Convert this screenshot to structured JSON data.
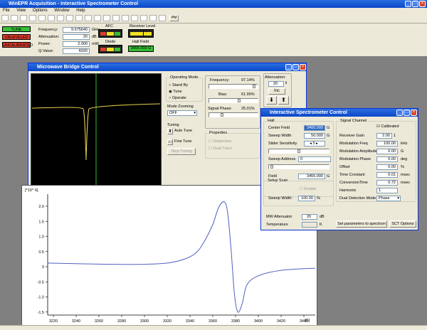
{
  "app": {
    "title": "WinEPR Acquisition - Interactive Spectrometer Control",
    "menu": [
      "File",
      "View",
      "Options",
      "Window",
      "Help"
    ],
    "toolbar_text": "PM"
  },
  "status": {
    "tune": "TUNE",
    "unleveled": "UNLEVELED",
    "uncalibrated": "UNCALIBRATED"
  },
  "top": {
    "frequency_label": "Frequency:",
    "frequency": "9.675640",
    "frequency_unit": "GHz",
    "attenuation_label": "Attenuation:",
    "attenuation": "20",
    "attenuation_unit": "dB",
    "power_label": "Power:",
    "power": "2.000",
    "power_unit": "mW",
    "qvalue_label": "Q-Value:",
    "qvalue": "6020",
    "afc": "AFC",
    "receiver_level": "Receiver Level",
    "diode": "Diode",
    "hall_field": "Hall Field",
    "hall_value": "3455.000 G"
  },
  "mw": {
    "title": "Microwave Bridge Control",
    "operating_mode": "Operating Mode",
    "standby": "Stand By",
    "tune": "Tune",
    "operate": "Operate",
    "mode_zooming": "Mode Zooming",
    "zoom_value": "OFF",
    "tuning": "Tuning",
    "auto_tune": "Auto Tune",
    "fine_tune": "Fine Tune",
    "stop_tuning": "Stop Tuning",
    "frequency_label": "Frequency:",
    "frequency_pct": "97.14%",
    "bias_label": "Bias:",
    "bias_pct": "61.95%",
    "signal_phase_label": "Signal Phase:",
    "signal_phase_pct": "25.01%",
    "attenuation_label": "Attenuation:",
    "attenuation_value": "20",
    "inc": "Inc",
    "properties": "Properties",
    "dispersion": "Dispersion",
    "dual_trace": "Dual Trace"
  },
  "isc": {
    "title": "Interactive Spectrometer Control",
    "hall": "Hall",
    "center_field_label": "Center Field",
    "center_field": "3400.000",
    "unit_g": "G",
    "sweep_width_label": "Sweep Width",
    "sweep_width": "50.000",
    "slider_sens_label": "Slider Sensitivity",
    "slider_sens": "5",
    "sweep_address_label": "Sweep Address",
    "sweep_address": "0",
    "field_label": "Field",
    "field": "3455.000",
    "setup_scan": "Setup Scan",
    "enable": "Enable",
    "setup_sweep_label": "Sweep Width:",
    "setup_sweep": "100.00",
    "pct": "%",
    "mw_att_label": "MW Attenuator",
    "mw_att": "20",
    "mw_att_unit": "dB",
    "temperature_label": "Temperature",
    "temp_unit": "K",
    "signal_channel": "Signal Channel",
    "calibrated": "Calibrated",
    "receiver_gain_label": "Receiver Gain",
    "receiver_gain": "2.00",
    "gain_exp": "1",
    "mod_freq_label": "Modulation Freq",
    "mod_freq": "100.00",
    "khz": "kHz",
    "mod_amp_label": "Modulation Amplitude",
    "mod_amp": "0.00",
    "mod_phase_label": "Modulation Phase",
    "mod_phase": "0.00",
    "deg": "deg",
    "offset_label": "Offset",
    "offset": "0.00",
    "time_const_label": "Time  Constant",
    "time_const": "0.01",
    "msec": "msec",
    "conv_time_label": "ConversionTime",
    "conv_time": "0.72",
    "harmonic_label": "Harmonic",
    "harmonic": "1",
    "dual_det_label": "Dual Detection Mode",
    "dual_det": "Phase",
    "set_params": "Set parameters to spectrum",
    "sct_options": "SCT Options"
  },
  "chart_data": {
    "type": "line",
    "title": "",
    "y_exponent_label": "[*10^ 6]",
    "x_unit_label": "[G]",
    "xlim": [
      3215,
      3450
    ],
    "ylim": [
      -1.6,
      2.4
    ],
    "xticks": [
      "3220",
      "3240",
      "3260",
      "3280",
      "3300",
      "3320",
      "3340",
      "3360",
      "3380",
      "3400",
      "3420",
      "3440"
    ],
    "yticks": [
      "2.0",
      "1.5",
      "1.0",
      "0.5",
      "0",
      "-0.5",
      "-1.0",
      "-1.5"
    ],
    "x": [
      3215,
      3240,
      3270,
      3300,
      3320,
      3335,
      3345,
      3352,
      3360,
      3365,
      3370,
      3373,
      3376,
      3379,
      3382,
      3386,
      3390,
      3400,
      3420,
      3450
    ],
    "y": [
      0.12,
      0.1,
      0.08,
      0.08,
      0.12,
      0.25,
      0.45,
      0.8,
      1.4,
      1.95,
      2.15,
      1.8,
      0.6,
      -0.9,
      -1.5,
      -1.2,
      -0.6,
      -0.3,
      -0.12,
      -0.05
    ],
    "color": "#5060c0"
  }
}
